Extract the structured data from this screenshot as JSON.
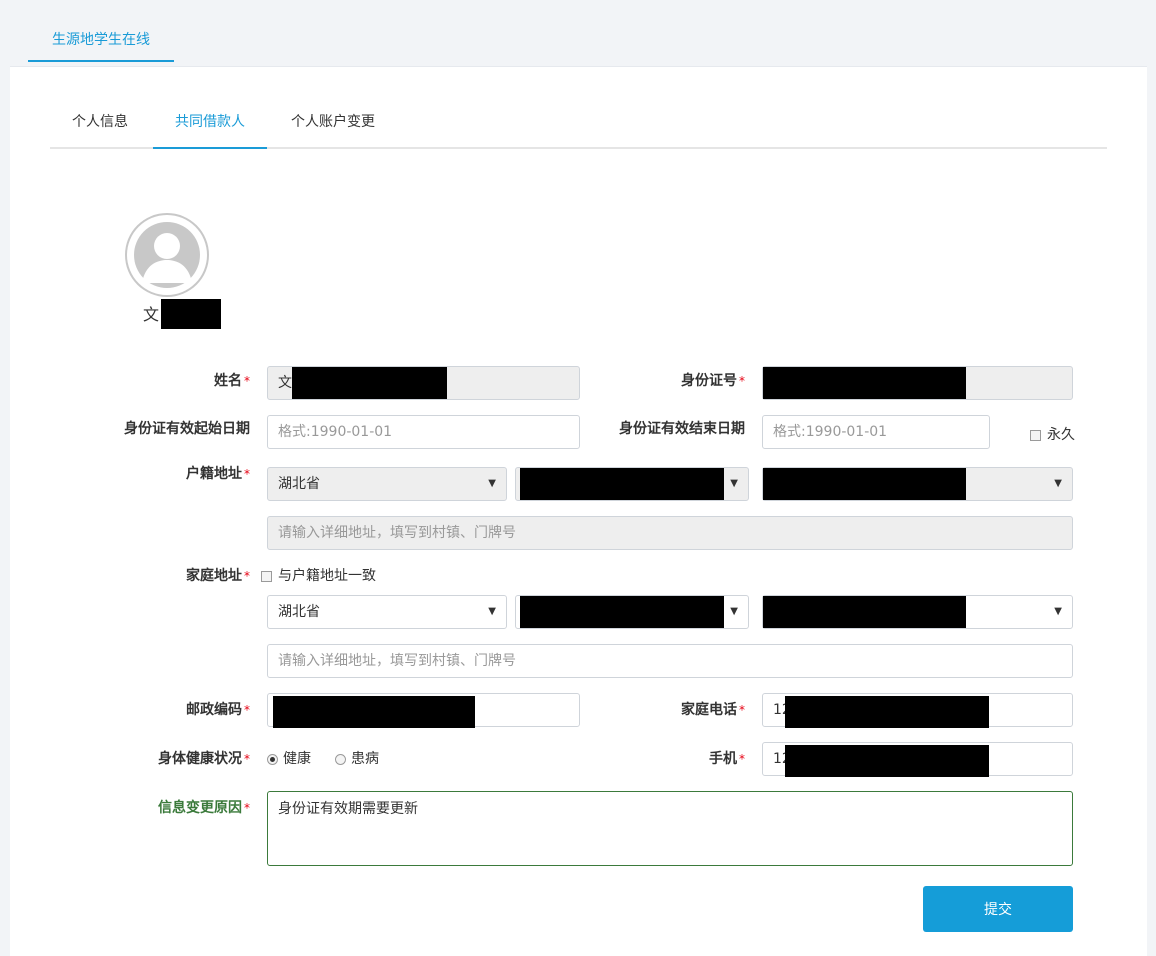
{
  "top_tab": {
    "label": "生源地学生在线"
  },
  "subtabs": [
    {
      "label": "个人信息"
    },
    {
      "label": "共同借款人"
    },
    {
      "label": "个人账户变更"
    }
  ],
  "profile": {
    "name_visible": "文"
  },
  "form": {
    "name": {
      "label": "姓名",
      "value": "文"
    },
    "id_number": {
      "label": "身份证号",
      "value": ""
    },
    "id_start_date": {
      "label": "身份证有效起始日期",
      "placeholder": "格式:1990-01-01"
    },
    "id_end_date": {
      "label": "身份证有效结束日期",
      "placeholder": "格式:1990-01-01"
    },
    "permanent": {
      "label": "永久",
      "checked": false
    },
    "hukou_address": {
      "label": "户籍地址",
      "province": "湖北省",
      "detail_placeholder": "请输入详细地址，填写到村镇、门牌号"
    },
    "home_address": {
      "label": "家庭地址",
      "same_as_hukou_label": "与户籍地址一致",
      "province": "湖北省",
      "detail_placeholder": "请输入详细地址，填写到村镇、门牌号"
    },
    "postal_code": {
      "label": "邮政编码",
      "value": ""
    },
    "home_phone": {
      "label": "家庭电话",
      "value": "12"
    },
    "health_status": {
      "label": "身体健康状况",
      "options": [
        "健康",
        "患病"
      ],
      "selected": "健康"
    },
    "mobile": {
      "label": "手机",
      "value": "12"
    },
    "change_reason": {
      "label": "信息变更原因",
      "value": "身份证有效期需要更新"
    },
    "required_mark": "*"
  },
  "submit_label": "提交",
  "colors": {
    "accent": "#1a9bd7",
    "button": "#159dd8",
    "required": "#e60012",
    "focus_green": "#3b7a3b"
  }
}
